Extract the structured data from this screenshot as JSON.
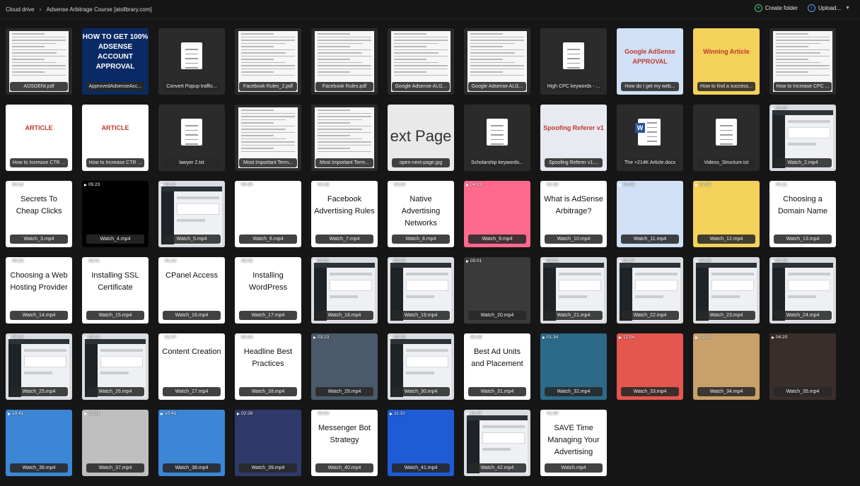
{
  "breadcrumb": {
    "root": "Cloud drive",
    "separator": "›",
    "current": "Adsense Arbitrage Course [atsllbrary.com]"
  },
  "toolbar": {
    "create_folder_label": "Create folder",
    "upload_label": "Upload..."
  },
  "files": [
    {
      "name": "ADSGENI.pdf",
      "kind": "doc",
      "accent": "#ffffff"
    },
    {
      "name": "ApprovedAdsenseAcc...",
      "kind": "poster",
      "poster": "HOW TO GET 100% ADSENSE ACCOUNT APPROVAL",
      "accent": "#0a2a66"
    },
    {
      "name": "Convert Popup traffic...",
      "kind": "file"
    },
    {
      "name": "Facebook Rules_2.pdf",
      "kind": "doc",
      "accent": "#ffffff"
    },
    {
      "name": "Facebook Rules.pdf",
      "kind": "doc",
      "accent": "#ffffff"
    },
    {
      "name": "Google Adsense ALG...",
      "kind": "doc",
      "accent": "#ffffff"
    },
    {
      "name": "Google Adsense ALG...",
      "kind": "doc",
      "accent": "#ffffff"
    },
    {
      "name": "High CPC keywords - ...",
      "kind": "file"
    },
    {
      "name": "How do I get my web...",
      "kind": "image",
      "accent": "#cfe0f7",
      "poster": "Google AdSense APPROVAL"
    },
    {
      "name": "How to find a success...",
      "kind": "image",
      "accent": "#f3d15a",
      "poster": "Winning Article"
    },
    {
      "name": "How to Increase CPC ...",
      "kind": "doc",
      "accent": "#ffffff"
    },
    {
      "name": "How to Increase CTR ...",
      "kind": "image",
      "accent": "#ffffff",
      "poster": "ARTICLE"
    },
    {
      "name": "How to Increase CTR ...",
      "kind": "image",
      "accent": "#ffffff",
      "poster": "ARTICLE"
    },
    {
      "name": "lawyer 2.txt",
      "kind": "file"
    },
    {
      "name": "Most Important Term...",
      "kind": "doc",
      "accent": "#ffffff"
    },
    {
      "name": "Most Important Term...",
      "kind": "doc",
      "accent": "#ffffff"
    },
    {
      "name": "open-next-page.jpg",
      "kind": "big",
      "poster": "ext Page",
      "accent": "#e9e9e9"
    },
    {
      "name": "Scholarship keywords...",
      "kind": "file"
    },
    {
      "name": "Spoofing Referer v1....",
      "kind": "image",
      "accent": "#e8eaf2",
      "poster": "Spoofing Referer v1"
    },
    {
      "name": "The +214K Article.docx",
      "kind": "word"
    },
    {
      "name": "Videos_Structure.txt",
      "kind": "file"
    },
    {
      "name": "Watch_2.mp4",
      "kind": "browser",
      "duration": "02:27"
    },
    {
      "name": "Watch_3.mp4",
      "kind": "video-title",
      "duration": "03:13",
      "poster": "Secrets To Cheap Clicks"
    },
    {
      "name": "Watch_4.mp4",
      "kind": "video-black",
      "duration": "05:23"
    },
    {
      "name": "Watch_5.mp4",
      "kind": "browser",
      "duration": "02:11"
    },
    {
      "name": "Watch_6.mp4",
      "kind": "video-blank",
      "duration": "08:40"
    },
    {
      "name": "Watch_7.mp4",
      "kind": "video-title",
      "duration": "02:26",
      "poster": "Facebook Advertising Rules"
    },
    {
      "name": "Watch_8.mp4",
      "kind": "video-title",
      "duration": "04:54",
      "poster": "Native Advertising Networks"
    },
    {
      "name": "Watch_9.mp4",
      "kind": "video-art",
      "duration": "04:23",
      "accent": "#ff6a8c"
    },
    {
      "name": "Watch_10.mp4",
      "kind": "video-title",
      "duration": "01:28",
      "poster": "What is AdSense Arbitrage?"
    },
    {
      "name": "Watch_11.mp4",
      "kind": "video-art",
      "duration": "03:09",
      "accent": "#cfe0f7"
    },
    {
      "name": "Watch_12.mp4",
      "kind": "video-art",
      "duration": "07:56",
      "accent": "#f3d15a"
    },
    {
      "name": "Watch_13.mp4",
      "kind": "video-title",
      "duration": "06:21",
      "poster": "Choosing a Domain Name"
    },
    {
      "name": "Watch_14.mp4",
      "kind": "video-title",
      "duration": "03:23",
      "poster": "Choosing a Web Hosting Provider"
    },
    {
      "name": "Watch_15.mp4",
      "kind": "video-title",
      "duration": "03:01",
      "poster": "Installing SSL Certificate"
    },
    {
      "name": "Watch_16.mp4",
      "kind": "video-title",
      "duration": "01:24",
      "poster": "CPanel Access"
    },
    {
      "name": "Watch_17.mp4",
      "kind": "video-title",
      "duration": "03:33",
      "poster": "Installing WordPress"
    },
    {
      "name": "Watch_18.mp4",
      "kind": "browser",
      "duration": "03:01"
    },
    {
      "name": "Watch_19.mp4",
      "kind": "browser",
      "duration": "02:25"
    },
    {
      "name": "Watch_20.mp4",
      "kind": "video-art",
      "duration": "05:01",
      "accent": "#3a3a3a"
    },
    {
      "name": "Watch_21.mp4",
      "kind": "browser",
      "duration": "03:01"
    },
    {
      "name": "Watch_22.mp4",
      "kind": "browser",
      "duration": "01:17"
    },
    {
      "name": "Watch_23.mp4",
      "kind": "browser",
      "duration": "03:49"
    },
    {
      "name": "Watch_24.mp4",
      "kind": "browser",
      "duration": "02:23"
    },
    {
      "name": "Watch_25.mp4",
      "kind": "browser",
      "duration": "04:16"
    },
    {
      "name": "Watch_26.mp4",
      "kind": "browser",
      "duration": "03:14"
    },
    {
      "name": "Watch_27.mp4",
      "kind": "video-title",
      "duration": "02:37",
      "poster": "Content Creation"
    },
    {
      "name": "Watch_28.mp4",
      "kind": "video-title",
      "duration": "02:03",
      "poster": "Headline Best Practices"
    },
    {
      "name": "Watch_29.mp4",
      "kind": "video-art",
      "duration": "03:23",
      "accent": "#4a5a6a"
    },
    {
      "name": "Watch_30.mp4",
      "kind": "browser",
      "duration": "02:53"
    },
    {
      "name": "Watch_31.mp4",
      "kind": "video-title",
      "duration": "05:28",
      "poster": "Best Ad Units and Placement"
    },
    {
      "name": "Watch_32.mp4",
      "kind": "video-art",
      "duration": "01:34",
      "accent": "#2d6a8a"
    },
    {
      "name": "Watch_33.mp4",
      "kind": "video-art",
      "duration": "12:04",
      "accent": "#e4574e"
    },
    {
      "name": "Watch_34.mp4",
      "kind": "video-art",
      "duration": "10:52",
      "accent": "#c9a06a"
    },
    {
      "name": "Watch_35.mp4",
      "kind": "video-art",
      "duration": "04:20",
      "accent": "#3a2e2a"
    },
    {
      "name": "Watch_36.mp4",
      "kind": "video-art",
      "duration": "10:41",
      "accent": "#3c86d6"
    },
    {
      "name": "Watch_37.mp4",
      "kind": "video-art",
      "duration": "10:31",
      "accent": "#bfbfbf"
    },
    {
      "name": "Watch_38.mp4",
      "kind": "video-art",
      "duration": "10:41",
      "accent": "#3c86d6"
    },
    {
      "name": "Watch_39.mp4",
      "kind": "video-art",
      "duration": "02:28",
      "accent": "#2e3b6a"
    },
    {
      "name": "Watch_40.mp4",
      "kind": "video-title",
      "duration": "03:54",
      "poster": "Messenger Bot Strategy"
    },
    {
      "name": "Watch_41.mp4",
      "kind": "video-art",
      "duration": "11:10",
      "accent": "#1e5bd6"
    },
    {
      "name": "Watch_42.mp4",
      "kind": "browser",
      "duration": "11:47"
    },
    {
      "name": "Watch.mp4",
      "kind": "video-title",
      "duration": "01:00",
      "poster": "SAVE Time Managing Your Advertising"
    }
  ]
}
